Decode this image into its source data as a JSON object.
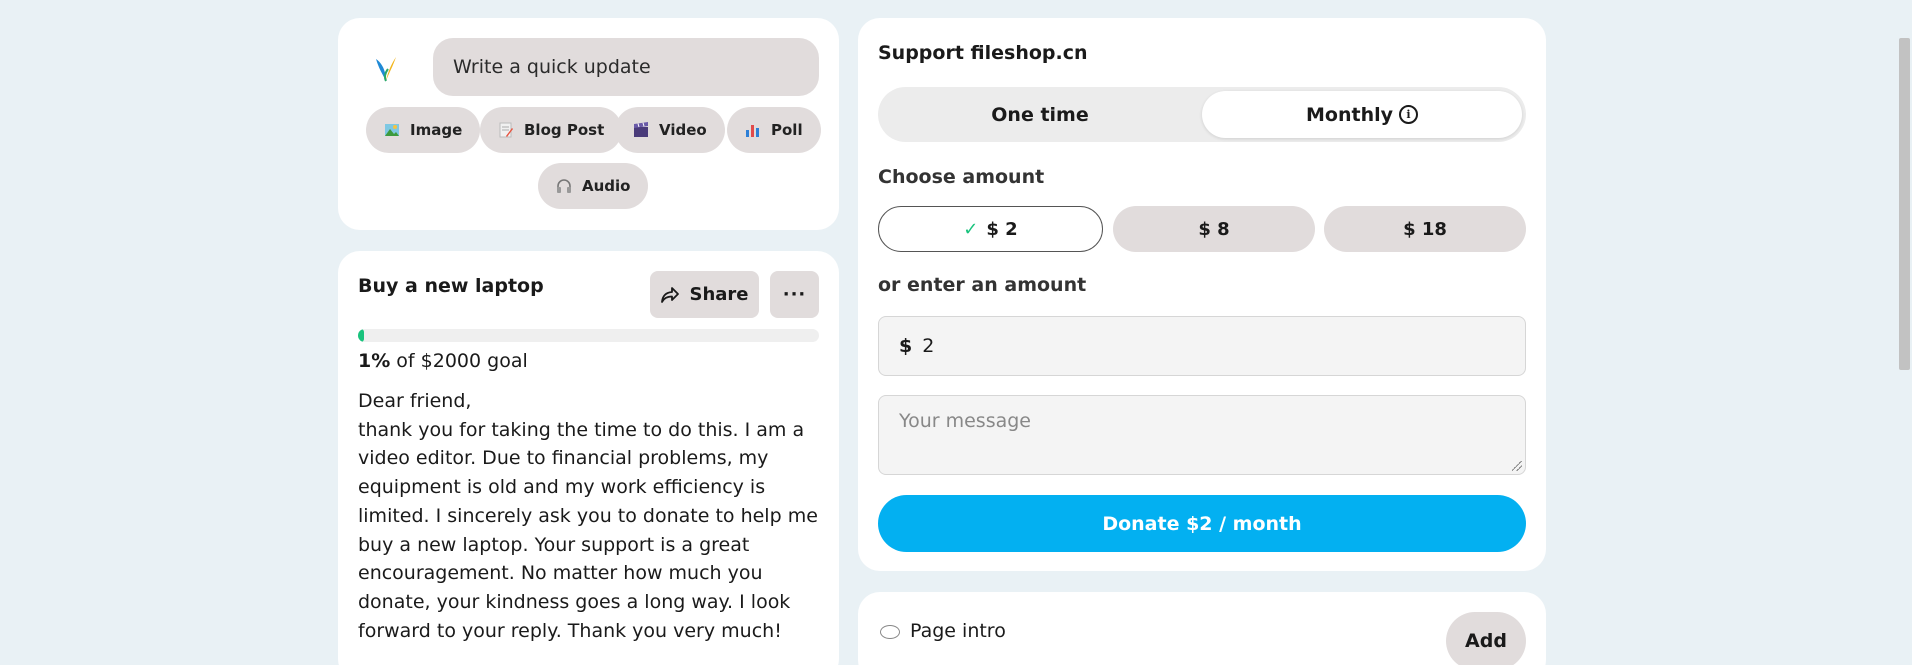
{
  "composer": {
    "placeholder": "Write a quick update",
    "chips": [
      {
        "label": "Image",
        "icon": "image-icon"
      },
      {
        "label": "Blog Post",
        "icon": "blog-post-icon"
      },
      {
        "label": "Video",
        "icon": "video-icon"
      },
      {
        "label": "Poll",
        "icon": "poll-icon"
      },
      {
        "label": "Audio",
        "icon": "headphones-icon"
      }
    ]
  },
  "goal": {
    "title": "Buy a new laptop",
    "share_label": "Share",
    "more_label": "···",
    "progress_fraction": 0.01,
    "percent": "1%",
    "goal_text": " of $2000 goal",
    "letter": "Dear friend,\nthank you for taking the time to do this. I am a video editor. Due to financial problems, my equipment is old and my work efficiency is limited. I sincerely ask you to donate to help me buy a new laptop. Your support is a great encouragement. No matter how much you donate, your kindness goes a long way. I look forward to your reply. Thank you very much!"
  },
  "support": {
    "title": "Support fileshop.cn",
    "one_time_label": "One time",
    "monthly_label": "Monthly",
    "selected_frequency": "Monthly",
    "choose_amount_label": "Choose amount",
    "amounts": [
      "$ 2",
      "$ 8",
      "$ 18"
    ],
    "selected_amount": "$ 2",
    "enter_amount_label": "or enter an amount",
    "currency_symbol": "$",
    "amount_value": "2",
    "message_placeholder": "Your message",
    "donate_label": "Donate $2 / month",
    "accent_color": "#03b0f1"
  },
  "intro": {
    "label": "Page intro",
    "add_label": "Add"
  }
}
